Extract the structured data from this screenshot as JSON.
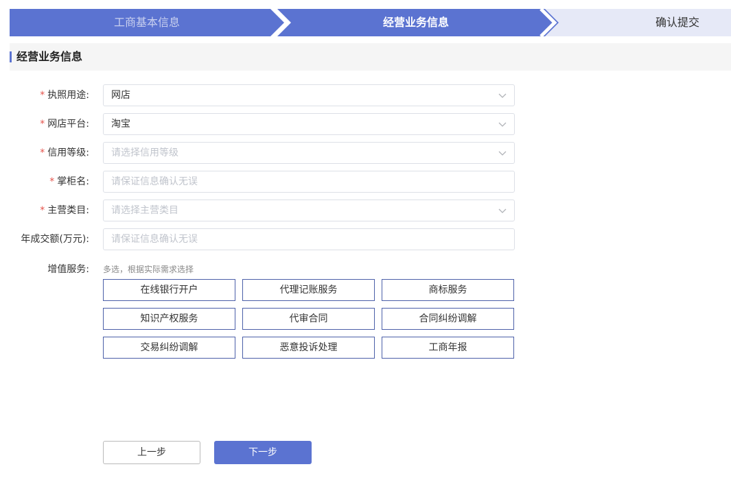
{
  "steps": {
    "step1": "工商基本信息",
    "step2": "经营业务信息",
    "step3": "确认提交"
  },
  "colors": {
    "accent": "#5b73d1",
    "step_inactive": "#e6e9f7",
    "required": "#e5534b"
  },
  "section": {
    "title": "经营业务信息"
  },
  "form": {
    "license_use": {
      "required": "*",
      "label": "执照用途:",
      "value": "网店"
    },
    "platform": {
      "required": "*",
      "label": "网店平台:",
      "value": "淘宝"
    },
    "credit": {
      "required": "*",
      "label": "信用等级:",
      "placeholder": "请选择信用等级"
    },
    "shopkeeper": {
      "required": "*",
      "label": "掌柜名:",
      "placeholder": "请保证信息确认无误"
    },
    "category": {
      "required": "*",
      "label": "主营类目:",
      "placeholder": "请选择主营类目"
    },
    "turnover": {
      "label": "年成交额(万元):",
      "placeholder": "请保证信息确认无误"
    }
  },
  "vas": {
    "label": "增值服务:",
    "hint": "多选，根据实际需求选择",
    "items": [
      "在线银行开户",
      "代理记账服务",
      "商标服务",
      "知识产权服务",
      "代审合同",
      "合同纠纷调解",
      "交易纠纷调解",
      "恶意投诉处理",
      "工商年报"
    ]
  },
  "actions": {
    "prev": "上一步",
    "next": "下一步"
  }
}
